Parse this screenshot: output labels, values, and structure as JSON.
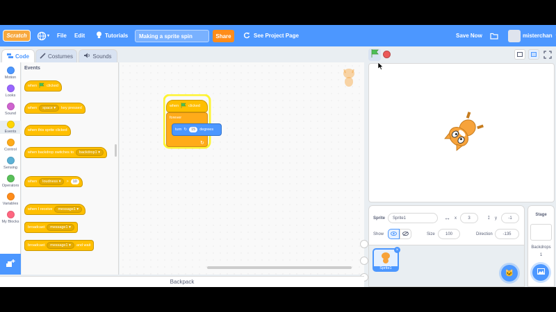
{
  "menu": {
    "logo": "Scratch",
    "file": "File",
    "edit": "Edit",
    "tutorials": "Tutorials",
    "project_title": "Making a sprite spin",
    "share": "Share",
    "see_project_page": "See Project Page",
    "save_now": "Save Now",
    "username": "misterchan"
  },
  "tabs": {
    "code": "Code",
    "costumes": "Costumes",
    "sounds": "Sounds"
  },
  "categories": [
    {
      "label": "Motion",
      "color": "#4c97ff"
    },
    {
      "label": "Looks",
      "color": "#9966ff"
    },
    {
      "label": "Sound",
      "color": "#cf63cf"
    },
    {
      "label": "Events",
      "color": "#ffd500"
    },
    {
      "label": "Control",
      "color": "#ffab19"
    },
    {
      "label": "Sensing",
      "color": "#5cb1d6"
    },
    {
      "label": "Operators",
      "color": "#59c059"
    },
    {
      "label": "Variables",
      "color": "#ff8c1a"
    },
    {
      "label": "My Blocks",
      "color": "#ff6680"
    }
  ],
  "palette": {
    "title": "Events",
    "when_flag": {
      "pre": "when",
      "post": "clicked"
    },
    "when_key": {
      "pre": "when",
      "key": "space",
      "post": "key pressed"
    },
    "when_sprite_clicked": "when this sprite clicked",
    "when_backdrop": {
      "pre": "when backdrop switches to",
      "value": "backdrop1"
    },
    "when_loudness": {
      "pre": "when",
      "sensor": "loudness",
      "op": ">",
      "value": "10"
    },
    "when_receive": {
      "pre": "when I receive",
      "msg": "message1"
    },
    "broadcast": {
      "pre": "broadcast",
      "msg": "message1"
    },
    "broadcast_wait": {
      "pre": "broadcast",
      "msg": "message1",
      "post": "and wait"
    }
  },
  "script": {
    "hat": {
      "pre": "when",
      "post": "clicked"
    },
    "forever": "forever",
    "turn": {
      "pre": "turn",
      "degrees": "15",
      "post": "degrees"
    }
  },
  "backpack": "Backpack",
  "sprite_info": {
    "sprite_label": "Sprite",
    "sprite_name": "Sprite1",
    "x_label": "x",
    "x": "3",
    "y_label": "y",
    "y": "-1",
    "show_label": "Show",
    "size_label": "Size",
    "size": "100",
    "direction_label": "Direction",
    "direction": "-135"
  },
  "sprite_tile": "Sprite1",
  "stage_panel": {
    "title": "Stage",
    "backdrops_label": "Backdrops",
    "backdrops_count": "1"
  },
  "colors": {
    "menu_blue": "#4c97ff",
    "events_yellow": "#ffbf00",
    "motion_blue": "#4c97ff",
    "share_orange": "#ff8c1a"
  }
}
